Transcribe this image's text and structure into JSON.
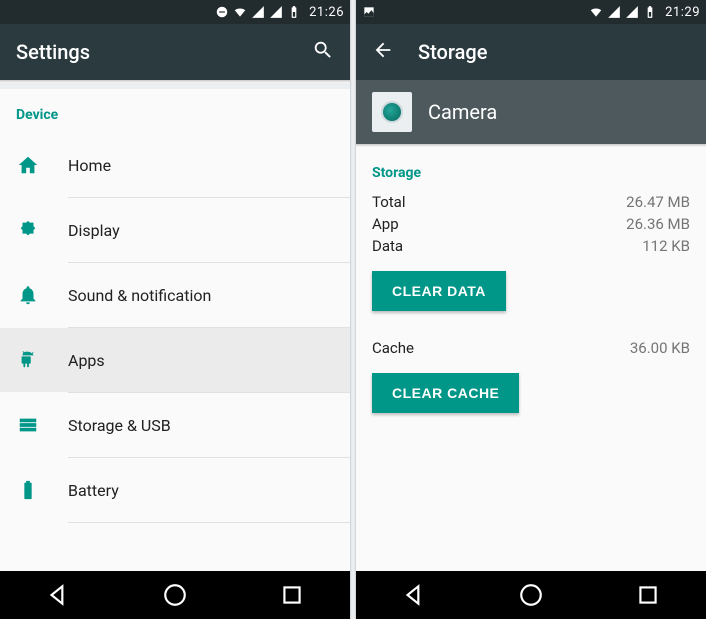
{
  "phone1": {
    "status_time": "21:26",
    "appbar_title": "Settings",
    "section": "Device",
    "items": [
      {
        "label": "Home"
      },
      {
        "label": "Display"
      },
      {
        "label": "Sound & notification"
      },
      {
        "label": "Apps"
      },
      {
        "label": "Storage & USB"
      },
      {
        "label": "Battery"
      }
    ]
  },
  "phone2": {
    "status_time": "21:29",
    "appbar_title": "Storage",
    "app_name": "Camera",
    "section": "Storage",
    "rows": {
      "total_label": "Total",
      "total_value": "26.47 MB",
      "app_label": "App",
      "app_value": "26.36 MB",
      "data_label": "Data",
      "data_value": "112 KB",
      "cache_label": "Cache",
      "cache_value": "36.00 KB"
    },
    "buttons": {
      "clear_data": "CLEAR DATA",
      "clear_cache": "CLEAR CACHE"
    }
  }
}
